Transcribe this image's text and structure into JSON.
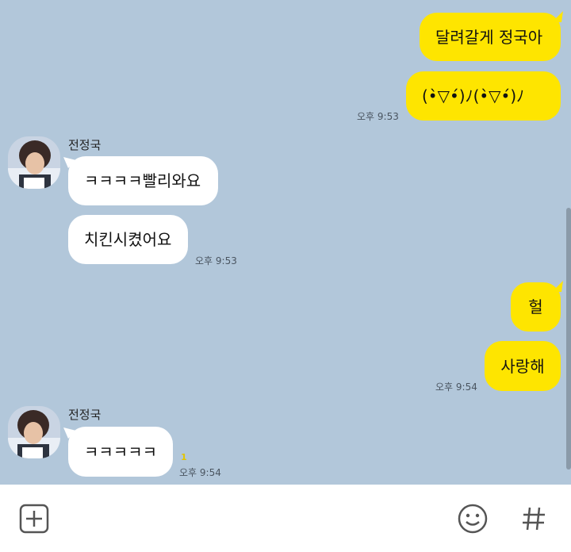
{
  "messages": {
    "m1": {
      "text": "달려갈게 정국아"
    },
    "m2": {
      "text": "(•̀▽•́)ﾉ(•̀▽•́)ﾉ",
      "time": "오후 9:53"
    },
    "m3": {
      "sender": "전정국",
      "text": "ㅋㅋㅋㅋ빨리와요"
    },
    "m4": {
      "text": "치킨시켰어요",
      "time": "오후 9:53"
    },
    "m5": {
      "text": "헐"
    },
    "m6": {
      "text": "사랑해",
      "time": "오후 9:54"
    },
    "m7": {
      "sender": "전정국",
      "text": "ㅋㅋㅋㅋㅋ",
      "unread": "1",
      "time": "오후 9:54"
    }
  },
  "icons": {
    "attach": "plus-square-icon",
    "emoji": "smiley-icon",
    "hashtag": "hashtag-icon"
  },
  "colors": {
    "chat_bg": "#b2c7da",
    "my_bubble": "#fee500",
    "other_bubble": "#ffffff"
  }
}
